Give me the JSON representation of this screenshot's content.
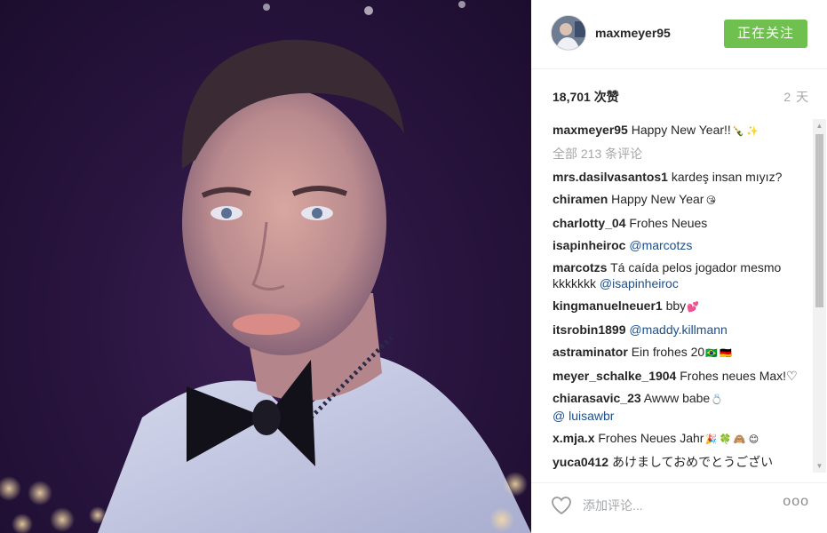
{
  "post": {
    "username": "maxmeyer95",
    "follow_label": "正在关注",
    "likes": "18,701 次赞",
    "time_ago": "2 天",
    "caption": "Happy New Year!!",
    "view_all_comments": "全部 213 条评论",
    "add_comment_placeholder": "添加评论...",
    "more_label": "ooo"
  },
  "comments": [
    {
      "user": "mrs.dasilvasantos1",
      "text": "kardeş insan mıyız?"
    },
    {
      "user": "chiramen",
      "text": "Happy New Year"
    },
    {
      "user": "charlotty_04",
      "text": "Frohes Neues"
    },
    {
      "user": "isapinheiroc",
      "mention": "@marcotzs"
    },
    {
      "user": "marcotzs",
      "text": "Tá caída pelos jogador mesmo kkkkkkk",
      "mention": "@isapinheiroc"
    },
    {
      "user": "kingmanuelneuer1",
      "text": "bby"
    },
    {
      "user": "itsrobin1899",
      "mention": "@maddy.killmann"
    },
    {
      "user": "astraminator",
      "text": "Ein frohes 20"
    },
    {
      "user": "meyer_schalke_1904",
      "text": "Frohes neues Max!♡"
    },
    {
      "user": "chiarasavic_23",
      "text": "Awww babe",
      "mention": "@ luisawbr"
    },
    {
      "user": "x.mja.x",
      "text": "Frohes Neues Jahr"
    },
    {
      "user": "yuca0412",
      "text": "あけましておめでとうござい"
    }
  ],
  "colors": {
    "follow_button": "#70c050",
    "mention": "#1c4f8b",
    "muted_text": "#a5a7aa"
  },
  "icons": [
    "heart-icon",
    "more-options-icon",
    "scroll-up-icon",
    "scroll-down-icon"
  ]
}
